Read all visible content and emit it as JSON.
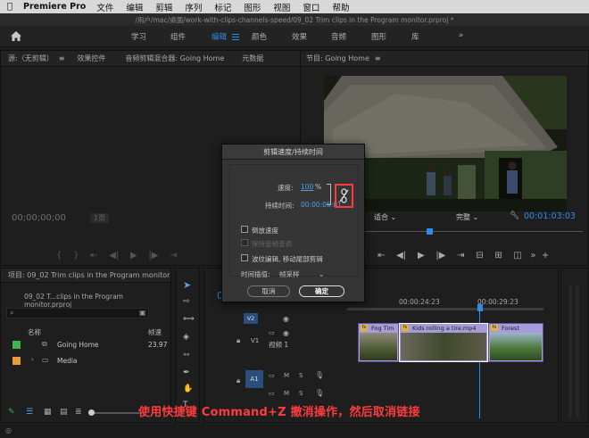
{
  "menubar": {
    "app_name": "Premiere Pro",
    "items": [
      "文件",
      "编辑",
      "剪辑",
      "序列",
      "标记",
      "图形",
      "视图",
      "窗口",
      "帮助"
    ]
  },
  "window_title": "/用户/mac/桌面/work-with-clips-channels-speed/09_02 Trim clips in the Program monitor.prproj *",
  "workspaces": {
    "tabs": [
      "学习",
      "组件",
      "编辑",
      "颜色",
      "效果",
      "音频",
      "图形",
      "库"
    ],
    "active": "编辑",
    "more": "»"
  },
  "source_panel": {
    "tabs": [
      "源:（无剪辑）",
      "效果控件",
      "音频剪辑混合器: Going Home",
      "元数据"
    ],
    "timecode": "00;00;00;00",
    "page": "1页"
  },
  "program_monitor": {
    "title": "节目: Going Home",
    "fit": "适合",
    "quality": "完整",
    "timecode": "00:01:03:03"
  },
  "dialog": {
    "title": "剪辑速度/持续时间",
    "speed_label": "速度:",
    "speed_value": "100",
    "speed_unit": "%",
    "duration_label": "持续时间:",
    "duration_value": "00:00:05:01",
    "reverse_label": "倒放速度",
    "reverse_checked": false,
    "maintain_pitch_label": "保持音频音调",
    "maintain_pitch_enabled": false,
    "ripple_label": "波纹编辑, 移动尾部剪辑",
    "ripple_checked": false,
    "interp_label": "时间插值:",
    "interp_value": "帧采样",
    "cancel": "取消",
    "ok": "确定"
  },
  "project_panel": {
    "title": "项目: 09_02 Trim clips in the Program monitor",
    "file": "09_02 T...clips in the Program monitor.prproj",
    "col_name": "名称",
    "col_rate": "帧速",
    "items": [
      {
        "name": "Going Home",
        "rate": "23.97",
        "color": "#3fb34f",
        "type": "sequence"
      },
      {
        "name": "Media",
        "rate": "",
        "color": "#e89c3a",
        "type": "folder"
      }
    ]
  },
  "timeline": {
    "timecode_left": "0",
    "ruler": [
      "00:00:24:23",
      "00:00:29:23"
    ],
    "tracks": [
      {
        "id": "V2",
        "name": ""
      },
      {
        "id": "V1",
        "name": "视频 1"
      },
      {
        "id": "A1",
        "name": ""
      }
    ],
    "clips": [
      {
        "name": "Fog Tim"
      },
      {
        "name": "Kids rolling a tire.mp4"
      },
      {
        "name": "Forest"
      }
    ]
  },
  "caption": "使用快捷键 Command+Z 撤消操作，然后取消链接"
}
